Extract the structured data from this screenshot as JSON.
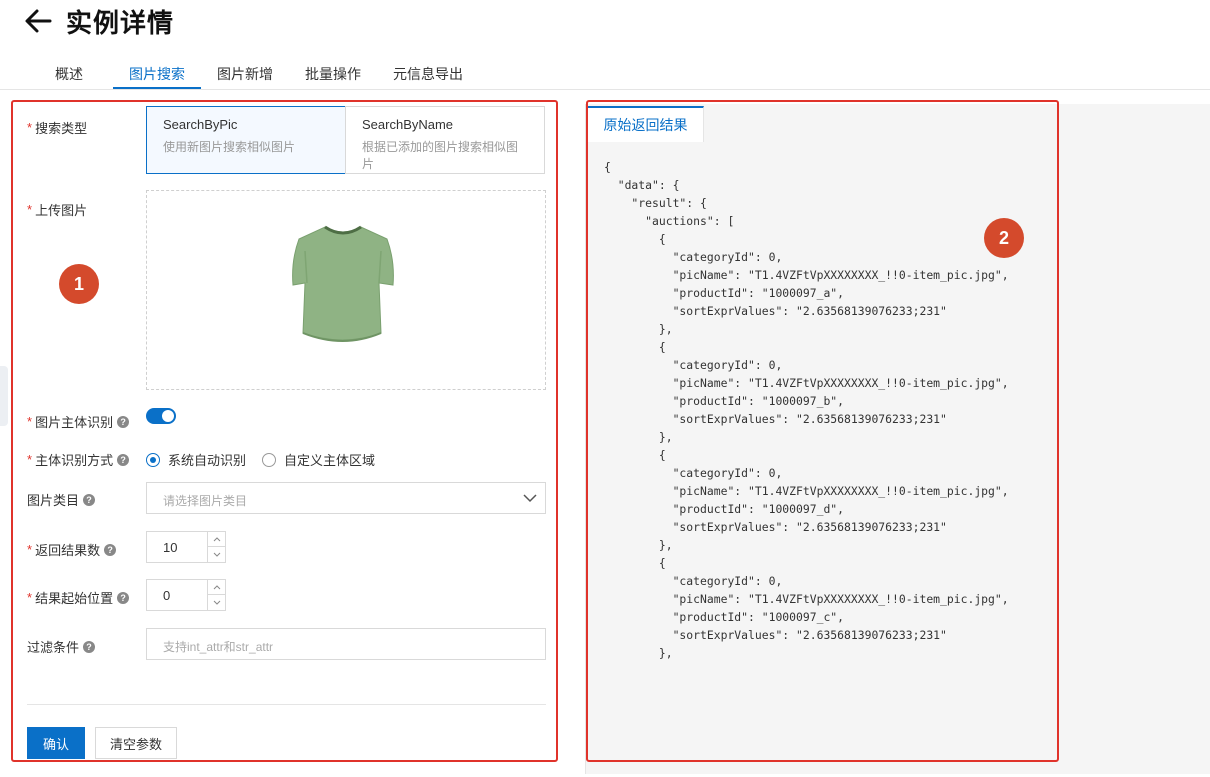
{
  "header": {
    "title": "实例详情",
    "tabs": [
      {
        "label": "概述"
      },
      {
        "label": "图片搜索"
      },
      {
        "label": "图片新增"
      },
      {
        "label": "批量操作"
      },
      {
        "label": "元信息导出"
      }
    ],
    "active_tab": "图片搜索"
  },
  "form": {
    "search_type": {
      "label": "搜索类型",
      "options": [
        {
          "title": "SearchByPic",
          "desc": "使用新图片搜索相似图片",
          "selected": true
        },
        {
          "title": "SearchByName",
          "desc": "根据已添加的图片搜索相似图片",
          "selected": false
        }
      ]
    },
    "upload": {
      "label": "上传图片"
    },
    "subject_detect": {
      "label": "图片主体识别",
      "enabled": true
    },
    "detect_mode": {
      "label": "主体识别方式",
      "options": [
        {
          "label": "系统自动识别",
          "checked": true
        },
        {
          "label": "自定义主体区域",
          "checked": false
        }
      ]
    },
    "category": {
      "label": "图片类目",
      "placeholder": "请选择图片类目"
    },
    "result_count": {
      "label": "返回结果数",
      "value": "10"
    },
    "start_position": {
      "label": "结果起始位置",
      "value": "0"
    },
    "filter": {
      "label": "过滤条件",
      "placeholder": "支持int_attr和str_attr"
    },
    "confirm_label": "确认",
    "clear_label": "清空参数"
  },
  "result": {
    "tab_label": "原始返回结果",
    "json_text": "{\n  \"data\": {\n    \"result\": {\n      \"auctions\": [\n        {\n          \"categoryId\": 0,\n          \"picName\": \"T1.4VZFtVpXXXXXXXX_!!0-item_pic.jpg\",\n          \"productId\": \"1000097_a\",\n          \"sortExprValues\": \"2.63568139076233;231\"\n        },\n        {\n          \"categoryId\": 0,\n          \"picName\": \"T1.4VZFtVpXXXXXXXX_!!0-item_pic.jpg\",\n          \"productId\": \"1000097_b\",\n          \"sortExprValues\": \"2.63568139076233;231\"\n        },\n        {\n          \"categoryId\": 0,\n          \"picName\": \"T1.4VZFtVpXXXXXXXX_!!0-item_pic.jpg\",\n          \"productId\": \"1000097_d\",\n          \"sortExprValues\": \"2.63568139076233;231\"\n        },\n        {\n          \"categoryId\": 0,\n          \"picName\": \"T1.4VZFtVpXXXXXXXX_!!0-item_pic.jpg\",\n          \"productId\": \"1000097_c\",\n          \"sortExprValues\": \"2.63568139076233;231\"\n        },"
  },
  "annotations": {
    "badge_1": "1",
    "badge_2": "2"
  },
  "colors": {
    "accent": "#0a70c8",
    "highlight_border": "#e0332b",
    "badge": "#d44a2c"
  },
  "icons": [
    "back-arrow-icon",
    "help-icon",
    "chevron-down-icon",
    "caret-up-icon",
    "caret-down-icon"
  ]
}
